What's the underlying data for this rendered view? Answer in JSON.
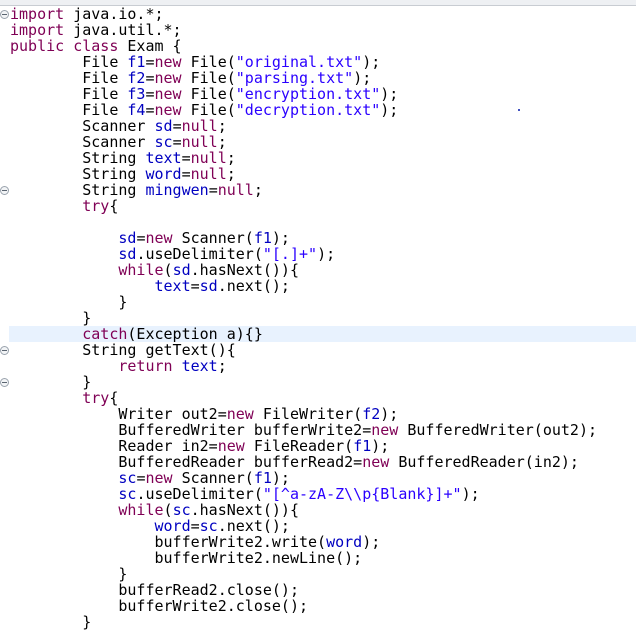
{
  "editor": {
    "current_line": 20,
    "folded_lines": [
      0,
      11,
      21,
      23
    ],
    "colors": {
      "keyword": "#7f0055",
      "field": "#0000c0",
      "string": "#2a00ff",
      "current_line": "#e8f2fe"
    },
    "lines": [
      [
        [
          "k",
          "import"
        ],
        [
          "p",
          " java.io.*;"
        ]
      ],
      [
        [
          "k",
          "import"
        ],
        [
          "p",
          " java.util.*;"
        ]
      ],
      [
        [
          "k",
          "public"
        ],
        [
          "p",
          " "
        ],
        [
          "k",
          "class"
        ],
        [
          "p",
          " Exam {"
        ]
      ],
      [
        [
          "p",
          "        File "
        ],
        [
          "f",
          "f1"
        ],
        [
          "p",
          "="
        ],
        [
          "k",
          "new"
        ],
        [
          "p",
          " File("
        ],
        [
          "s",
          "\"original.txt\""
        ],
        [
          "p",
          ");"
        ]
      ],
      [
        [
          "p",
          "        File "
        ],
        [
          "f",
          "f2"
        ],
        [
          "p",
          "="
        ],
        [
          "k",
          "new"
        ],
        [
          "p",
          " File("
        ],
        [
          "s",
          "\"parsing.txt\""
        ],
        [
          "p",
          ");"
        ]
      ],
      [
        [
          "p",
          "        File "
        ],
        [
          "f",
          "f3"
        ],
        [
          "p",
          "="
        ],
        [
          "k",
          "new"
        ],
        [
          "p",
          " File("
        ],
        [
          "s",
          "\"encryption.txt\""
        ],
        [
          "p",
          ");"
        ]
      ],
      [
        [
          "p",
          "        File "
        ],
        [
          "f",
          "f4"
        ],
        [
          "p",
          "="
        ],
        [
          "k",
          "new"
        ],
        [
          "p",
          " File("
        ],
        [
          "s",
          "\"decryption.txt\""
        ],
        [
          "p",
          ");"
        ]
      ],
      [
        [
          "p",
          "        Scanner "
        ],
        [
          "f",
          "sd"
        ],
        [
          "p",
          "="
        ],
        [
          "k",
          "null"
        ],
        [
          "p",
          ";"
        ]
      ],
      [
        [
          "p",
          "        Scanner "
        ],
        [
          "f",
          "sc"
        ],
        [
          "p",
          "="
        ],
        [
          "k",
          "null"
        ],
        [
          "p",
          ";"
        ]
      ],
      [
        [
          "p",
          "        String "
        ],
        [
          "f",
          "text"
        ],
        [
          "p",
          "="
        ],
        [
          "k",
          "null"
        ],
        [
          "p",
          ";"
        ]
      ],
      [
        [
          "p",
          "        String "
        ],
        [
          "f",
          "word"
        ],
        [
          "p",
          "="
        ],
        [
          "k",
          "null"
        ],
        [
          "p",
          ";"
        ]
      ],
      [
        [
          "p",
          "        String "
        ],
        [
          "f",
          "mingwen"
        ],
        [
          "p",
          "="
        ],
        [
          "k",
          "null"
        ],
        [
          "p",
          ";"
        ]
      ],
      [
        [
          "p",
          "        "
        ],
        [
          "k",
          "try"
        ],
        [
          "p",
          "{"
        ]
      ],
      [],
      [
        [
          "p",
          "            "
        ],
        [
          "f",
          "sd"
        ],
        [
          "p",
          "="
        ],
        [
          "k",
          "new"
        ],
        [
          "p",
          " Scanner("
        ],
        [
          "f",
          "f1"
        ],
        [
          "p",
          ");"
        ]
      ],
      [
        [
          "p",
          "            "
        ],
        [
          "f",
          "sd"
        ],
        [
          "p",
          ".useDelimiter("
        ],
        [
          "s",
          "\"[.]+\""
        ],
        [
          "p",
          ");"
        ]
      ],
      [
        [
          "p",
          "            "
        ],
        [
          "k",
          "while"
        ],
        [
          "p",
          "("
        ],
        [
          "f",
          "sd"
        ],
        [
          "p",
          ".hasNext()){"
        ]
      ],
      [
        [
          "p",
          "                "
        ],
        [
          "f",
          "text"
        ],
        [
          "p",
          "="
        ],
        [
          "f",
          "sd"
        ],
        [
          "p",
          ".next();"
        ]
      ],
      [
        [
          "p",
          "            }"
        ]
      ],
      [
        [
          "p",
          "        }"
        ]
      ],
      [
        [
          "p",
          "        "
        ],
        [
          "k",
          "catch"
        ],
        [
          "p",
          "(Exception a){}"
        ]
      ],
      [
        [
          "p",
          "        String getText(){"
        ]
      ],
      [
        [
          "p",
          "            "
        ],
        [
          "k",
          "return"
        ],
        [
          "p",
          " "
        ],
        [
          "f",
          "text"
        ],
        [
          "p",
          ";"
        ]
      ],
      [
        [
          "p",
          "        }"
        ]
      ],
      [
        [
          "p",
          "        "
        ],
        [
          "k",
          "try"
        ],
        [
          "p",
          "{"
        ]
      ],
      [
        [
          "p",
          "            Writer out2="
        ],
        [
          "k",
          "new"
        ],
        [
          "p",
          " FileWriter("
        ],
        [
          "f",
          "f2"
        ],
        [
          "p",
          ");"
        ]
      ],
      [
        [
          "p",
          "            BufferedWriter bufferWrite2="
        ],
        [
          "k",
          "new"
        ],
        [
          "p",
          " BufferedWriter(out2);"
        ]
      ],
      [
        [
          "p",
          "            Reader in2="
        ],
        [
          "k",
          "new"
        ],
        [
          "p",
          " FileReader("
        ],
        [
          "f",
          "f1"
        ],
        [
          "p",
          ");"
        ]
      ],
      [
        [
          "p",
          "            BufferedReader bufferRead2="
        ],
        [
          "k",
          "new"
        ],
        [
          "p",
          " BufferedReader(in2);"
        ]
      ],
      [
        [
          "p",
          "            "
        ],
        [
          "f",
          "sc"
        ],
        [
          "p",
          "="
        ],
        [
          "k",
          "new"
        ],
        [
          "p",
          " Scanner("
        ],
        [
          "f",
          "f1"
        ],
        [
          "p",
          ");"
        ]
      ],
      [
        [
          "p",
          "            "
        ],
        [
          "f",
          "sc"
        ],
        [
          "p",
          ".useDelimiter("
        ],
        [
          "s",
          "\"[^a-zA-Z\\\\p{Blank}]+\""
        ],
        [
          "p",
          ");"
        ]
      ],
      [
        [
          "p",
          "            "
        ],
        [
          "k",
          "while"
        ],
        [
          "p",
          "("
        ],
        [
          "f",
          "sc"
        ],
        [
          "p",
          ".hasNext()){"
        ]
      ],
      [
        [
          "p",
          "                "
        ],
        [
          "f",
          "word"
        ],
        [
          "p",
          "="
        ],
        [
          "f",
          "sc"
        ],
        [
          "p",
          ".next();"
        ]
      ],
      [
        [
          "p",
          "                bufferWrite2.write("
        ],
        [
          "f",
          "word"
        ],
        [
          "p",
          ");"
        ]
      ],
      [
        [
          "p",
          "                bufferWrite2.newLine();"
        ]
      ],
      [
        [
          "p",
          "            }"
        ]
      ],
      [
        [
          "p",
          "            bufferRead2.close();"
        ]
      ],
      [
        [
          "p",
          "            bufferWrite2.close();"
        ]
      ],
      [
        [
          "p",
          "        }"
        ]
      ]
    ]
  }
}
